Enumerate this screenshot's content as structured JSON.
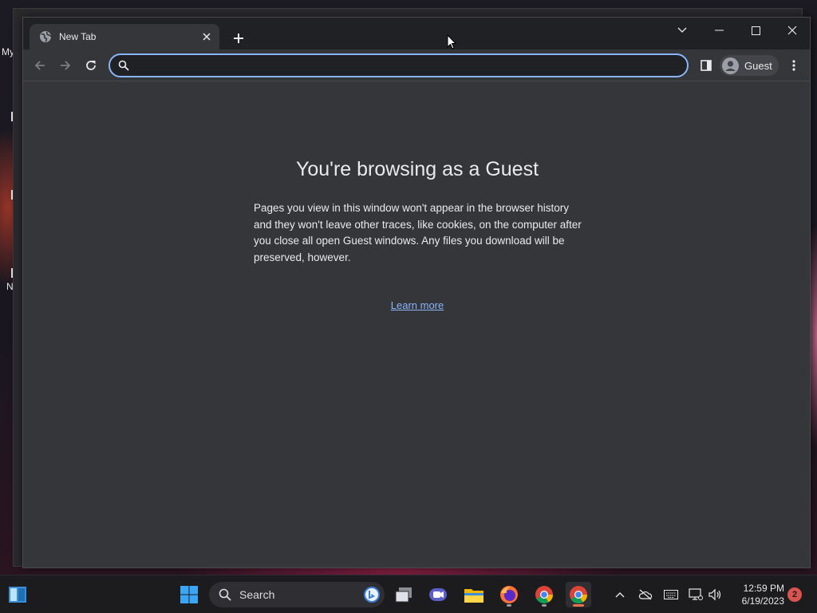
{
  "desktop": {
    "label_top": "My",
    "label_bottom": "N"
  },
  "browser": {
    "tab": {
      "title": "New Tab",
      "favicon": "globe-icon"
    },
    "controls": {
      "new_tab": "plus-icon",
      "tab_search": "chevron-down-icon",
      "minimize": "minimize-icon",
      "maximize": "maximize-icon",
      "close": "close-icon"
    },
    "toolbar": {
      "back": "arrow-left-icon",
      "forward": "arrow-right-icon",
      "reload": "reload-icon",
      "omnibox_value": "",
      "omnibox_placeholder": "",
      "side_panel": "side-panel-icon",
      "profile_label": "Guest",
      "menu": "more-vert-icon"
    },
    "page": {
      "heading": "You're browsing as a Guest",
      "body": "Pages you view in this window won't appear in the browser history and they won't leave other traces, like cookies, on the computer after you close all open Guest windows. Any files you download will be preserved, however.",
      "learn_more": "Learn more"
    }
  },
  "taskbar": {
    "search_label": "Search",
    "apps": [
      "windows-start-icon",
      "start-icon",
      "task-view-icon",
      "teams-icon",
      "file-explorer-icon",
      "firefox-icon",
      "chrome-icon",
      "chrome-icon"
    ],
    "tray": [
      "chevron-up-icon",
      "onedrive-offline-icon",
      "keyboard-icon",
      "network-icon",
      "volume-icon"
    ],
    "clock_time": "12:59 PM",
    "clock_date": "6/19/2023",
    "notification_count": "2"
  },
  "colors": {
    "accent": "#8ab4f8",
    "window_bg": "#35363a",
    "titlebar_bg": "#202124",
    "text": "#e8eaed",
    "taskbar_bg": "#1c1c1f",
    "badge": "#d9534f"
  }
}
